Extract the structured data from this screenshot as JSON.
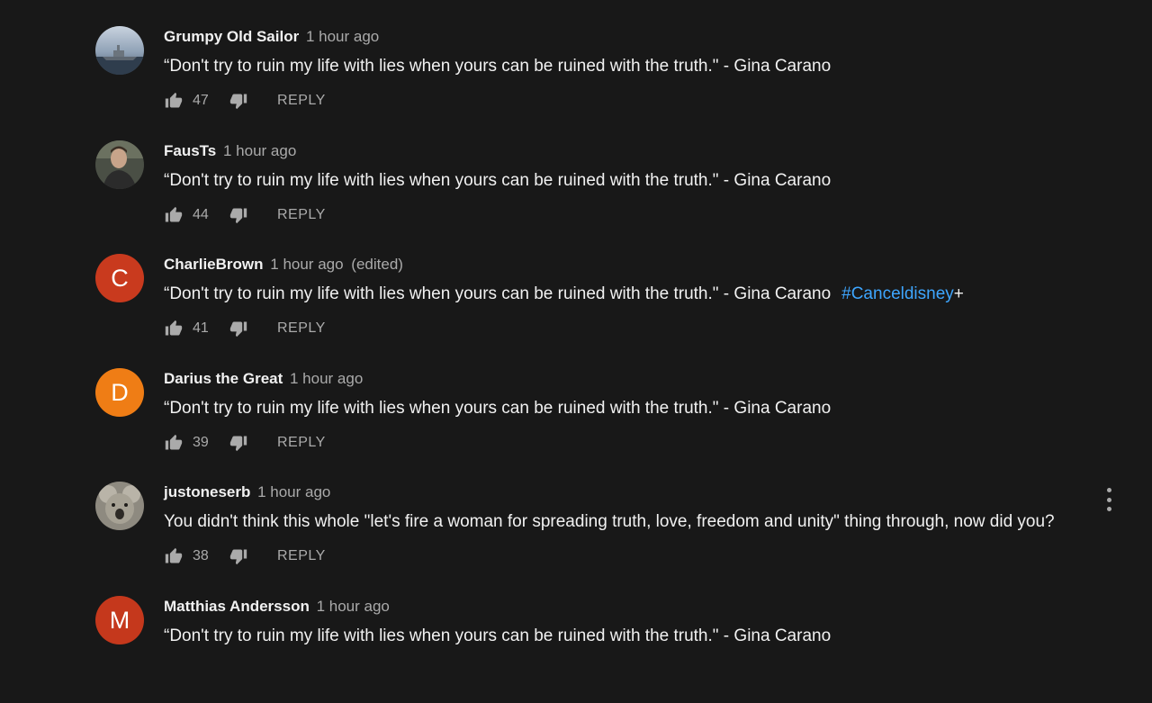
{
  "colors": {
    "background": "#181818",
    "text_primary": "#f1f1f1",
    "text_secondary": "#aaaaaa",
    "link": "#3ea6ff",
    "avatar_charlie": "#c93a1e",
    "avatar_darius": "#ef7d15",
    "avatar_matthias": "#c5381c"
  },
  "icons": {
    "like": "thumb-up-icon",
    "dislike": "thumb-down-icon",
    "menu": "more-vert-icon"
  },
  "comments": [
    {
      "author": "Grumpy Old Sailor",
      "time": "1 hour ago",
      "text": "“Don't try to ruin my life with lies when yours can be ruined with the truth.\" - Gina Carano",
      "likes": "47",
      "reply_label": "REPLY",
      "avatar_type": "photo-warship"
    },
    {
      "author": "FausTs",
      "time": "1 hour ago",
      "text": "“Don't try to ruin my life with lies when yours can be ruined with the truth.\" - Gina Carano",
      "likes": "44",
      "reply_label": "REPLY",
      "avatar_type": "photo-person"
    },
    {
      "author": "CharlieBrown",
      "time": "1 hour ago",
      "edited": "(edited)",
      "text": "“Don't try to ruin my life with lies when yours can be ruined with the truth.\" - Gina Carano",
      "hashtag": "#Canceldisney",
      "hashtag_suffix": "+",
      "likes": "41",
      "reply_label": "REPLY",
      "avatar_letter": "C"
    },
    {
      "author": "Darius the Great",
      "time": "1 hour ago",
      "text": "“Don't try to ruin my life with lies when yours can be ruined with the truth.\" - Gina Carano",
      "likes": "39",
      "reply_label": "REPLY",
      "avatar_letter": "D"
    },
    {
      "author": "justoneserb",
      "time": "1 hour ago",
      "text": "You didn't think this whole \"let's fire a woman for spreading truth, love, freedom and unity\" thing through, now did you?",
      "likes": "38",
      "reply_label": "REPLY",
      "avatar_type": "photo-koala"
    },
    {
      "author": "Matthias Andersson",
      "time": "1 hour ago",
      "text": "“Don't try to ruin my life with lies when yours can be ruined with the truth.\" - Gina Carano",
      "avatar_letter": "M"
    }
  ]
}
